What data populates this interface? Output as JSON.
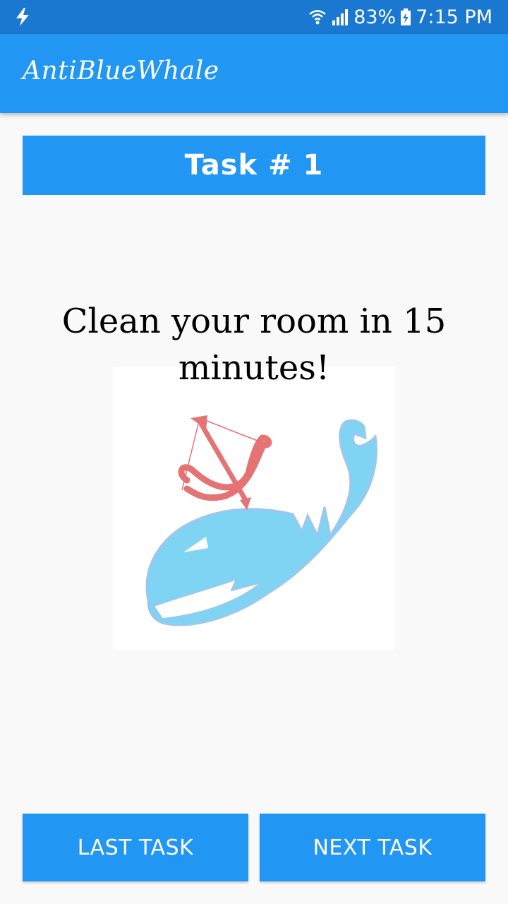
{
  "status_bar": {
    "battery_percent": "83%",
    "time": "7:15 PM",
    "icons": [
      "charging-bolt-icon",
      "wifi-icon",
      "cell-signal-icon",
      "battery-charging-icon"
    ]
  },
  "app_bar": {
    "title": "AntiBlueWhale"
  },
  "task": {
    "header": "Task # 1",
    "description": "Clean your room in 15 minutes!",
    "image_icon": "whale-with-bow-and-arrow-logo"
  },
  "buttons": {
    "last_task": "LAST TASK",
    "next_task": "NEXT TASK"
  },
  "colors": {
    "status_bar": "#1b78d0",
    "primary": "#2196f3",
    "background": "#f9f9f9",
    "whale": "#7fd3f3",
    "bow": "#e57373"
  }
}
